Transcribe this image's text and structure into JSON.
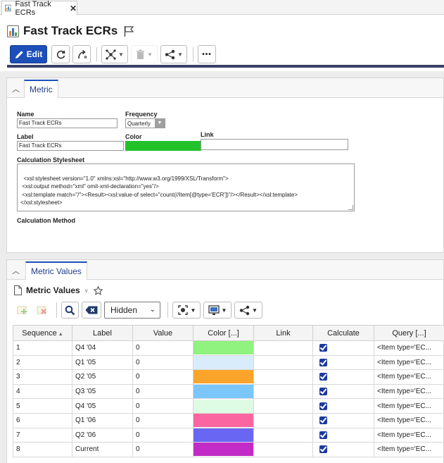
{
  "tab": {
    "label": "Fast Track ECRs",
    "close": "✕"
  },
  "header": {
    "title": "Fast Track ECRs"
  },
  "toolbar": {
    "edit_label": "Edit",
    "more_label": "•••"
  },
  "metric_panel": {
    "tab_label": "Metric",
    "name_label": "Name",
    "name_value": "Fast Track ECRs",
    "frequency_label": "Frequency",
    "frequency_value": "Quarterly",
    "label_label": "Label",
    "label_value": "Fast Track ECRs",
    "color_label": "Color",
    "color_value": "#22c12a",
    "link_label": "Link",
    "link_value": "",
    "stylesheet_label": "Calculation Stylesheet",
    "stylesheet_value": "<xsl:stylesheet version=\"1.0\" xmlns:xsl=\"http://www.w3.org/1999/XSL/Transform\">\n <xsl:output method=\"xml\" omit-xml-declaration=\"yes\"/>\n <xsl:template match=\"/\"><Result><xsl:value-of select=\"count(//Item[@type='ECR'])\"/></Result></xsl:template>\n</xsl:stylesheet>",
    "method_label": "Calculation Method"
  },
  "values_panel": {
    "tab_label": "Metric Values",
    "title": "Metric Values",
    "view_select": "Hidden",
    "columns": [
      "Sequence",
      "Label",
      "Value",
      "Color [...]",
      "Link",
      "Calculate",
      "Query [...]"
    ],
    "rows": [
      {
        "sequence": "1",
        "label": "Q4 '04",
        "value": "0",
        "color": "#90f27f",
        "link": "",
        "calculate": true,
        "query": "<Item type='EC..."
      },
      {
        "sequence": "2",
        "label": "Q1 '05",
        "value": "0",
        "color": "#d9ecfb",
        "link": "",
        "calculate": true,
        "query": "<Item type='EC..."
      },
      {
        "sequence": "3",
        "label": "Q2 '05",
        "value": "0",
        "color": "#fba42c",
        "link": "",
        "calculate": true,
        "query": "<Item type='EC..."
      },
      {
        "sequence": "4",
        "label": "Q3 '05",
        "value": "0",
        "color": "#7bc6fa",
        "link": "",
        "calculate": true,
        "query": "<Item type='EC..."
      },
      {
        "sequence": "5",
        "label": "Q4 '05",
        "value": "0",
        "color": "#defbe3",
        "link": "",
        "calculate": true,
        "query": "<Item type='EC..."
      },
      {
        "sequence": "6",
        "label": "Q1 '06",
        "value": "0",
        "color": "#fa669f",
        "link": "",
        "calculate": true,
        "query": "<Item type='EC..."
      },
      {
        "sequence": "7",
        "label": "Q2 '06",
        "value": "0",
        "color": "#6a66f4",
        "link": "",
        "calculate": true,
        "query": "<Item type='EC..."
      },
      {
        "sequence": "8",
        "label": "Current",
        "value": "0",
        "color": "#c22bc6",
        "link": "",
        "calculate": true,
        "query": "<Item type='EC..."
      }
    ]
  },
  "colors": {
    "accent": "#1d4fb8",
    "toolbar_rule": "#3a3f66",
    "checkbox": "#1d3a9e"
  }
}
